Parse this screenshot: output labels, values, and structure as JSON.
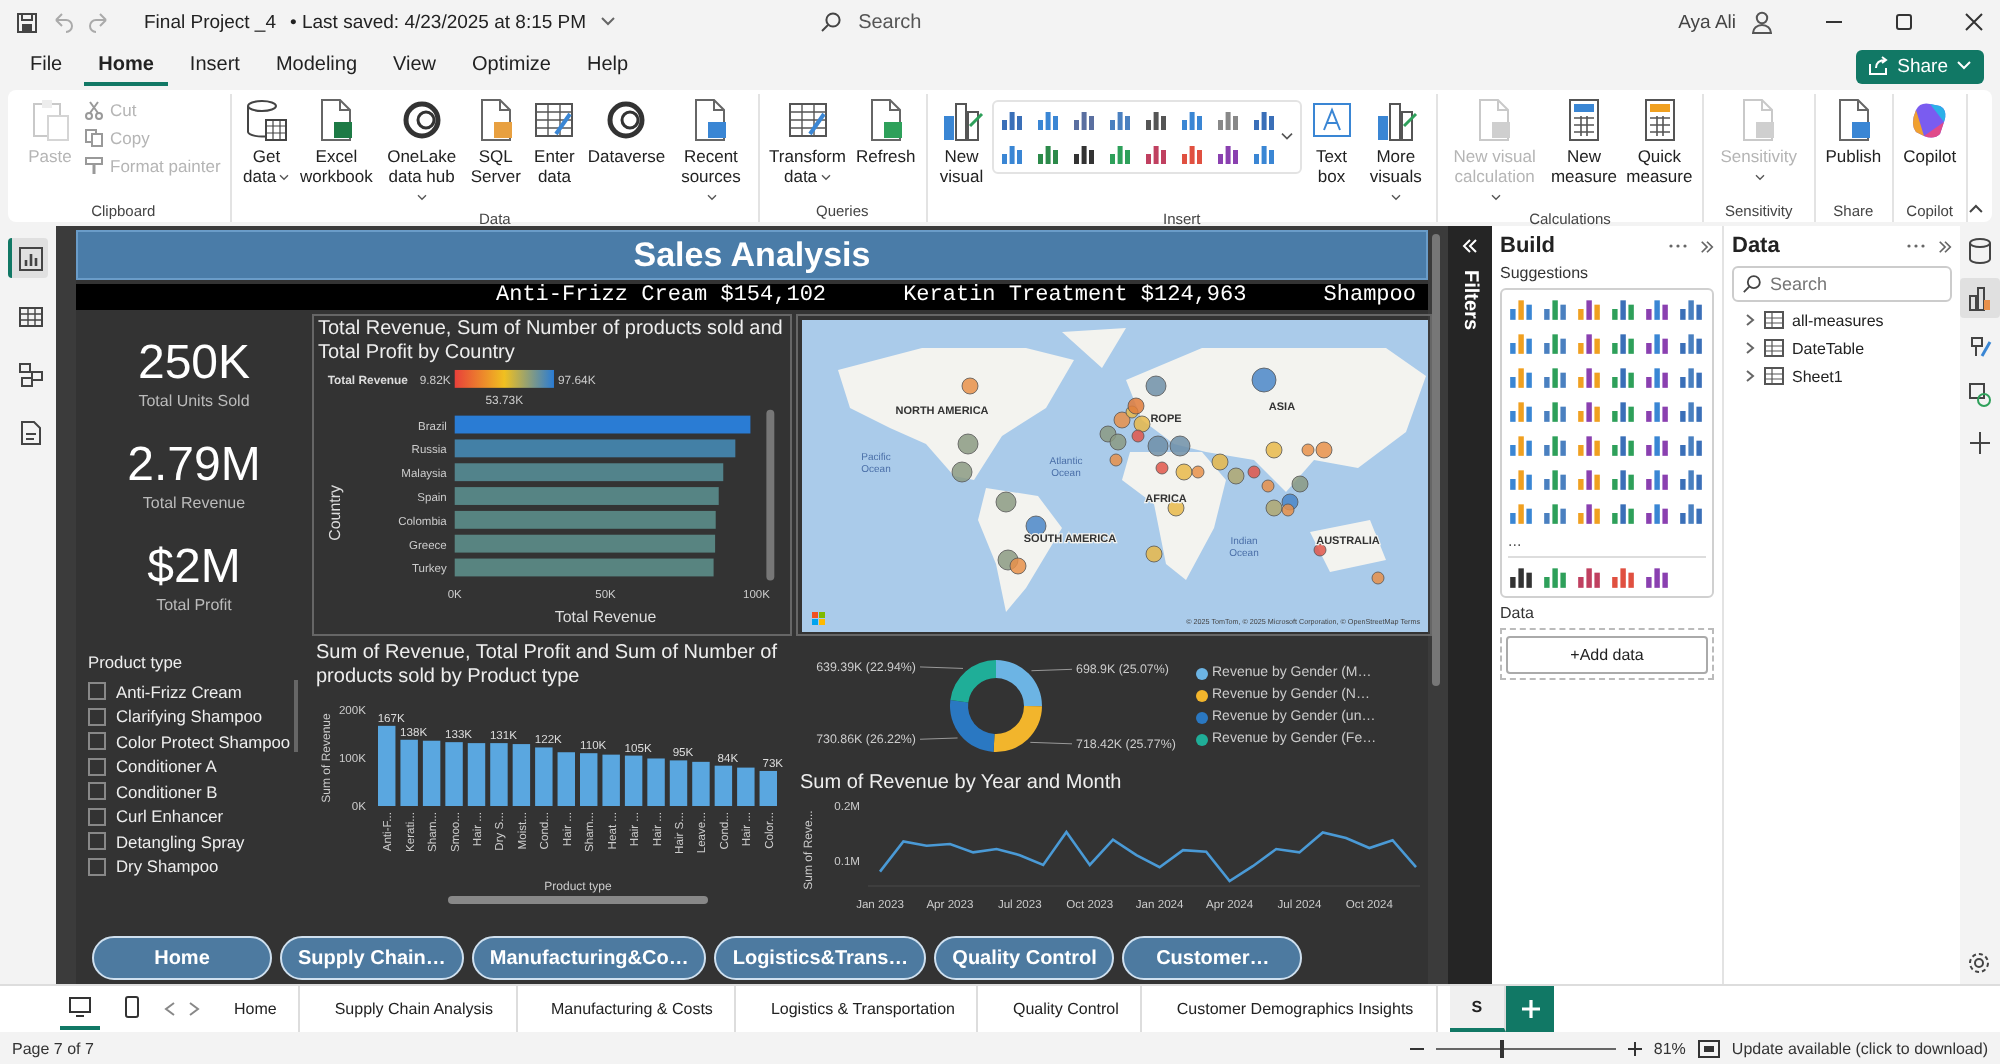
{
  "window": {
    "file_name": "Final Project _4",
    "save_status": "• Last saved: 4/23/2025 at 8:15 PM",
    "search": {
      "placeholder": "Search"
    },
    "user": "Aya Ali"
  },
  "menu_tabs": [
    {
      "label": "File",
      "selected": false
    },
    {
      "label": "Home",
      "selected": true
    },
    {
      "label": "Insert",
      "selected": false
    },
    {
      "label": "Modeling",
      "selected": false
    },
    {
      "label": "View",
      "selected": false
    },
    {
      "label": "Optimize",
      "selected": false
    },
    {
      "label": "Help",
      "selected": false
    }
  ],
  "share_button": "Share",
  "ribbon": [
    {
      "label": "Clipboard",
      "items": [
        {
          "kind": "large",
          "label": "Paste",
          "disabled": true,
          "dropdown": false
        },
        {
          "kind": "small",
          "label": "Cut",
          "disabled": true
        },
        {
          "kind": "small",
          "label": "Copy",
          "disabled": true
        },
        {
          "kind": "small",
          "label": "Format painter",
          "disabled": true
        }
      ]
    },
    {
      "label": "Data",
      "items": [
        {
          "kind": "large",
          "label": "Get\ndata",
          "disabled": false,
          "dropdown": true
        },
        {
          "kind": "large",
          "label": "Excel\nworkbook",
          "disabled": false,
          "dropdown": false
        },
        {
          "kind": "large",
          "label": "OneLake\ndata hub",
          "disabled": false,
          "dropdown": true
        },
        {
          "kind": "large",
          "label": "SQL\nServer",
          "disabled": false,
          "dropdown": false
        },
        {
          "kind": "large",
          "label": "Enter\ndata",
          "disabled": false,
          "dropdown": false
        },
        {
          "kind": "large",
          "label": "Dataverse",
          "disabled": false,
          "dropdown": false
        },
        {
          "kind": "large",
          "label": "Recent\nsources",
          "disabled": false,
          "dropdown": true
        }
      ]
    },
    {
      "label": "Queries",
      "items": [
        {
          "kind": "large",
          "label": "Transform\ndata",
          "disabled": false,
          "dropdown": true
        },
        {
          "kind": "large",
          "label": "Refresh",
          "disabled": false,
          "dropdown": false
        }
      ]
    },
    {
      "label": "Insert",
      "items": [
        {
          "kind": "large",
          "label": "New\nvisual",
          "disabled": false,
          "dropdown": false
        },
        {
          "kind": "gallery"
        },
        {
          "kind": "large",
          "label": "Text\nbox",
          "disabled": false,
          "dropdown": false
        },
        {
          "kind": "large",
          "label": "More\nvisuals",
          "disabled": false,
          "dropdown": true
        }
      ]
    },
    {
      "label": "Calculations",
      "items": [
        {
          "kind": "large",
          "label": "New visual\ncalculation",
          "disabled": true,
          "dropdown": true
        },
        {
          "kind": "large",
          "label": "New\nmeasure",
          "disabled": false,
          "dropdown": false
        },
        {
          "kind": "large",
          "label": "Quick\nmeasure",
          "disabled": false,
          "dropdown": false
        }
      ]
    },
    {
      "label": "Sensitivity",
      "items": [
        {
          "kind": "large",
          "label": "Sensitivity",
          "disabled": true,
          "dropdown": true
        }
      ]
    },
    {
      "label": "Share",
      "items": [
        {
          "kind": "large",
          "label": "Publish",
          "disabled": false,
          "dropdown": false
        }
      ]
    },
    {
      "label": "Copilot",
      "items": [
        {
          "kind": "large",
          "label": "Copilot",
          "disabled": false,
          "dropdown": false
        }
      ]
    }
  ],
  "left_rail": [
    {
      "selected": true
    },
    {
      "selected": false
    },
    {
      "selected": false
    },
    {
      "selected": false
    }
  ],
  "report": {
    "title": "Sales Analysis",
    "ticker": [
      "Anti-Frizz Cream $154,102",
      "Keratin Treatment $124,963",
      "Shampoo"
    ],
    "kpis": [
      {
        "value": "250K",
        "label": "Total Units Sold"
      },
      {
        "value": "2.79M",
        "label": "Total Revenue"
      },
      {
        "value": "$2M",
        "label": "Total Profit"
      }
    ],
    "country_chart": {
      "legend": {
        "title": "Total Revenue",
        "min": "9.82K",
        "max": "97.64K",
        "mid": "53.73K"
      },
      "chart_data": {
        "type": "bar",
        "orientation": "horizontal",
        "title": "Total Revenue, Sum of Number of products sold and Total Profit by Country",
        "xlabel": "Total Revenue",
        "ylabel": "Country",
        "categories": [
          "Brazil",
          "Russia",
          "Malaysia",
          "Spain",
          "Colombia",
          "Greece",
          "Turkey"
        ],
        "values": [
          98000,
          93000,
          89000,
          87500,
          86500,
          86300,
          85800
        ],
        "xlim": [
          0,
          100000
        ],
        "xticks": [
          {
            "value": 0,
            "label": "0K"
          },
          {
            "value": 50000,
            "label": "50K"
          },
          {
            "value": 100000,
            "label": "100K"
          }
        ]
      }
    },
    "map": {
      "labels": [
        "NORTH AMERICA",
        "ROPE",
        "ASIA",
        "Pacific\nOcean",
        "Atlantic\nOcean",
        "AFRICA",
        "SOUTH AMERICA",
        "Indian\nOcean",
        "AUSTRALIA"
      ],
      "attribution": "© 2025 TomTom, © 2025 Microsoft Corporation, © OpenStreetMap  Terms"
    },
    "slicer": {
      "title": "Product type",
      "items": [
        {
          "label": "Anti-Frizz Cream",
          "checked": false
        },
        {
          "label": "Clarifying Shampoo",
          "checked": false
        },
        {
          "label": "Color Protect Shampoo",
          "checked": false
        },
        {
          "label": "Conditioner A",
          "checked": false
        },
        {
          "label": "Conditioner B",
          "checked": false
        },
        {
          "label": "Curl Enhancer",
          "checked": false
        },
        {
          "label": "Detangling Spray",
          "checked": false
        },
        {
          "label": "Dry Shampoo",
          "checked": false
        }
      ]
    },
    "product_chart": {
      "chart_data": {
        "type": "bar",
        "title": "Sum of Revenue, Total Profit and Sum of Number of products sold by Product type",
        "xlabel": "Product type",
        "ylabel": "Sum of Revenue",
        "categories": [
          "Anti-F...",
          "Kerati...",
          "Sham...",
          "Smoo...",
          "Hair ...",
          "Dry S...",
          "Moist...",
          "Cond...",
          "Hair ...",
          "Sham...",
          "Heat ...",
          "Hair ...",
          "Hair ...",
          "Hair S...",
          "Leave...",
          "Cond...",
          "Hair ...",
          "Color..."
        ],
        "values": [
          167000,
          138000,
          136000,
          133000,
          131000,
          131000,
          129000,
          122000,
          112000,
          110000,
          107000,
          105000,
          99000,
          95000,
          92000,
          84000,
          80000,
          73000
        ],
        "value_labels": [
          "167K",
          "138K",
          null,
          "133K",
          null,
          "131K",
          null,
          "122K",
          null,
          "110K",
          null,
          "105K",
          null,
          "95K",
          null,
          "84K",
          null,
          "73K"
        ],
        "ylim": [
          0,
          200000
        ],
        "yticks": [
          {
            "value": 0,
            "label": "0K"
          },
          {
            "value": 100000,
            "label": "100K"
          },
          {
            "value": 200000,
            "label": "200K"
          }
        ]
      }
    },
    "gender_donut": {
      "chart_data": {
        "type": "donut",
        "categories": [
          "Revenue by Gender (M…",
          "Revenue by Gender (N…",
          "Revenue by Gender (un…",
          "Revenue by Gender (Fe…"
        ],
        "values": [
          698900,
          718420,
          730860,
          639390
        ],
        "value_labels": [
          "698.9K (25.07%)",
          "718.42K (25.77%)",
          "730.86K (26.22%)",
          "639.39K (22.94%)"
        ],
        "colors": [
          "#6cb4e4",
          "#f2b52c",
          "#2a78c2",
          "#1fae98"
        ],
        "legend": "right"
      }
    },
    "revenue_line": {
      "chart_data": {
        "type": "line",
        "title": "Sum of Revenue by Year and Month",
        "ylabel": "Sum of Reve...",
        "values": [
          0.081,
          0.136,
          0.128,
          0.131,
          0.116,
          0.122,
          0.111,
          0.093,
          0.153,
          0.093,
          0.139,
          0.111,
          0.089,
          0.12,
          0.117,
          0.064,
          0.091,
          0.122,
          0.116,
          0.152,
          0.142,
          0.124,
          0.138,
          0.089
        ],
        "categories": [
          "Jan 2023",
          null,
          null,
          "Apr 2023",
          null,
          null,
          "Jul 2023",
          null,
          null,
          "Oct 2023",
          null,
          null,
          "Jan 2024",
          null,
          null,
          "Apr 2024",
          null,
          null,
          "Jul 2024",
          null,
          null,
          "Oct 2024",
          null,
          null
        ],
        "ylim": [
          0.055,
          0.2
        ],
        "yticks": [
          {
            "value": 0.1,
            "label": "0.1M"
          },
          {
            "value": 0.2,
            "label": "0.2M"
          }
        ]
      }
    },
    "nav_buttons": [
      "Home",
      "Supply Chain…",
      "Manufacturing&Co…",
      "Logistics&Trans…",
      "Quality Control",
      "Customer…"
    ]
  },
  "filters_pane": {
    "label": "Filters"
  },
  "build_pane": {
    "title": "Build",
    "suggestions_label": "Suggestions",
    "more": "...",
    "data_label": "Data",
    "add_data": "+Add data"
  },
  "data_pane": {
    "title": "Data",
    "search": {
      "placeholder": "Search"
    },
    "items": [
      {
        "label": "all-measures",
        "expanded": false
      },
      {
        "label": "DateTable",
        "expanded": false
      },
      {
        "label": "Sheet1",
        "expanded": false
      }
    ]
  },
  "right_rail": [
    {
      "selected": false
    },
    {
      "selected": true
    },
    {
      "selected": false
    },
    {
      "selected": false
    },
    {
      "selected": false
    }
  ],
  "layout_views": [
    {
      "selected": true
    },
    {
      "selected": false
    }
  ],
  "page_tabs": [
    {
      "label": "Home",
      "selected": false
    },
    {
      "label": "Supply Chain Analysis",
      "selected": false
    },
    {
      "label": "Manufacturing & Costs",
      "selected": false
    },
    {
      "label": "Logistics & Transportation",
      "selected": false
    },
    {
      "label": "Quality Control",
      "selected": false
    },
    {
      "label": "Customer Demographics Insights",
      "selected": false
    },
    {
      "label": "S",
      "selected": true
    }
  ],
  "status_bar": {
    "page": "Page 7 of 7",
    "zoom_slider": {
      "level": 0.36
    },
    "zoom": "81%",
    "update": "Update available (click to download)"
  }
}
